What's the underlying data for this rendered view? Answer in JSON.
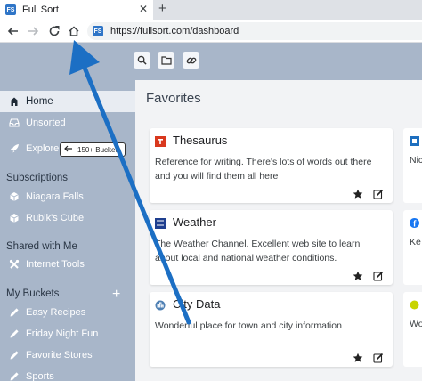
{
  "browser": {
    "tab_favicon": "FS",
    "tab_title": "Full Sort",
    "tab_close": "✕",
    "new_tab": "+",
    "url": "https://fullsort.com/dashboard"
  },
  "sidebar": {
    "home": "Home",
    "unsorted": "Unsorted",
    "explore": "Explore",
    "explore_tooltip": "150+ Buckets",
    "subscriptions_header": "Subscriptions",
    "subscriptions": [
      "Niagara Falls",
      "Rubik's Cube"
    ],
    "shared_header": "Shared with Me",
    "shared": [
      "Internet Tools"
    ],
    "buckets_header": "My Buckets",
    "add_bucket": "+",
    "buckets": [
      "Easy Recipes",
      "Friday Night Fun",
      "Favorite Stores",
      "Sports"
    ]
  },
  "main": {
    "title": "Favorites",
    "cards": [
      {
        "title": "Thesaurus",
        "description": "Reference for writing. There's lots of words out there and you will find them all here",
        "icon": "thesaurus-icon",
        "icon_color": "#d9381e"
      },
      {
        "title": "Weather",
        "description": "The Weather Channel. Excellent web site to learn about local and national weather conditions.",
        "icon": "weather-channel-icon",
        "icon_color": "#1f3f8f"
      },
      {
        "title": "City Data",
        "description": "Wonderful place for town and city information",
        "icon": "city-data-icon",
        "icon_color": "#4d7fb3"
      }
    ],
    "peek_cards": [
      {
        "text": "Nic",
        "icon": "blue-square-icon"
      },
      {
        "text": "Ke",
        "icon": "facebook-icon"
      },
      {
        "text": "Wo",
        "icon": "green-dot-icon"
      }
    ]
  },
  "colors": {
    "sidebar_bg": "#a8b6c9",
    "main_bg": "#f2f3f5",
    "annotation_arrow": "#1c6fc4"
  }
}
